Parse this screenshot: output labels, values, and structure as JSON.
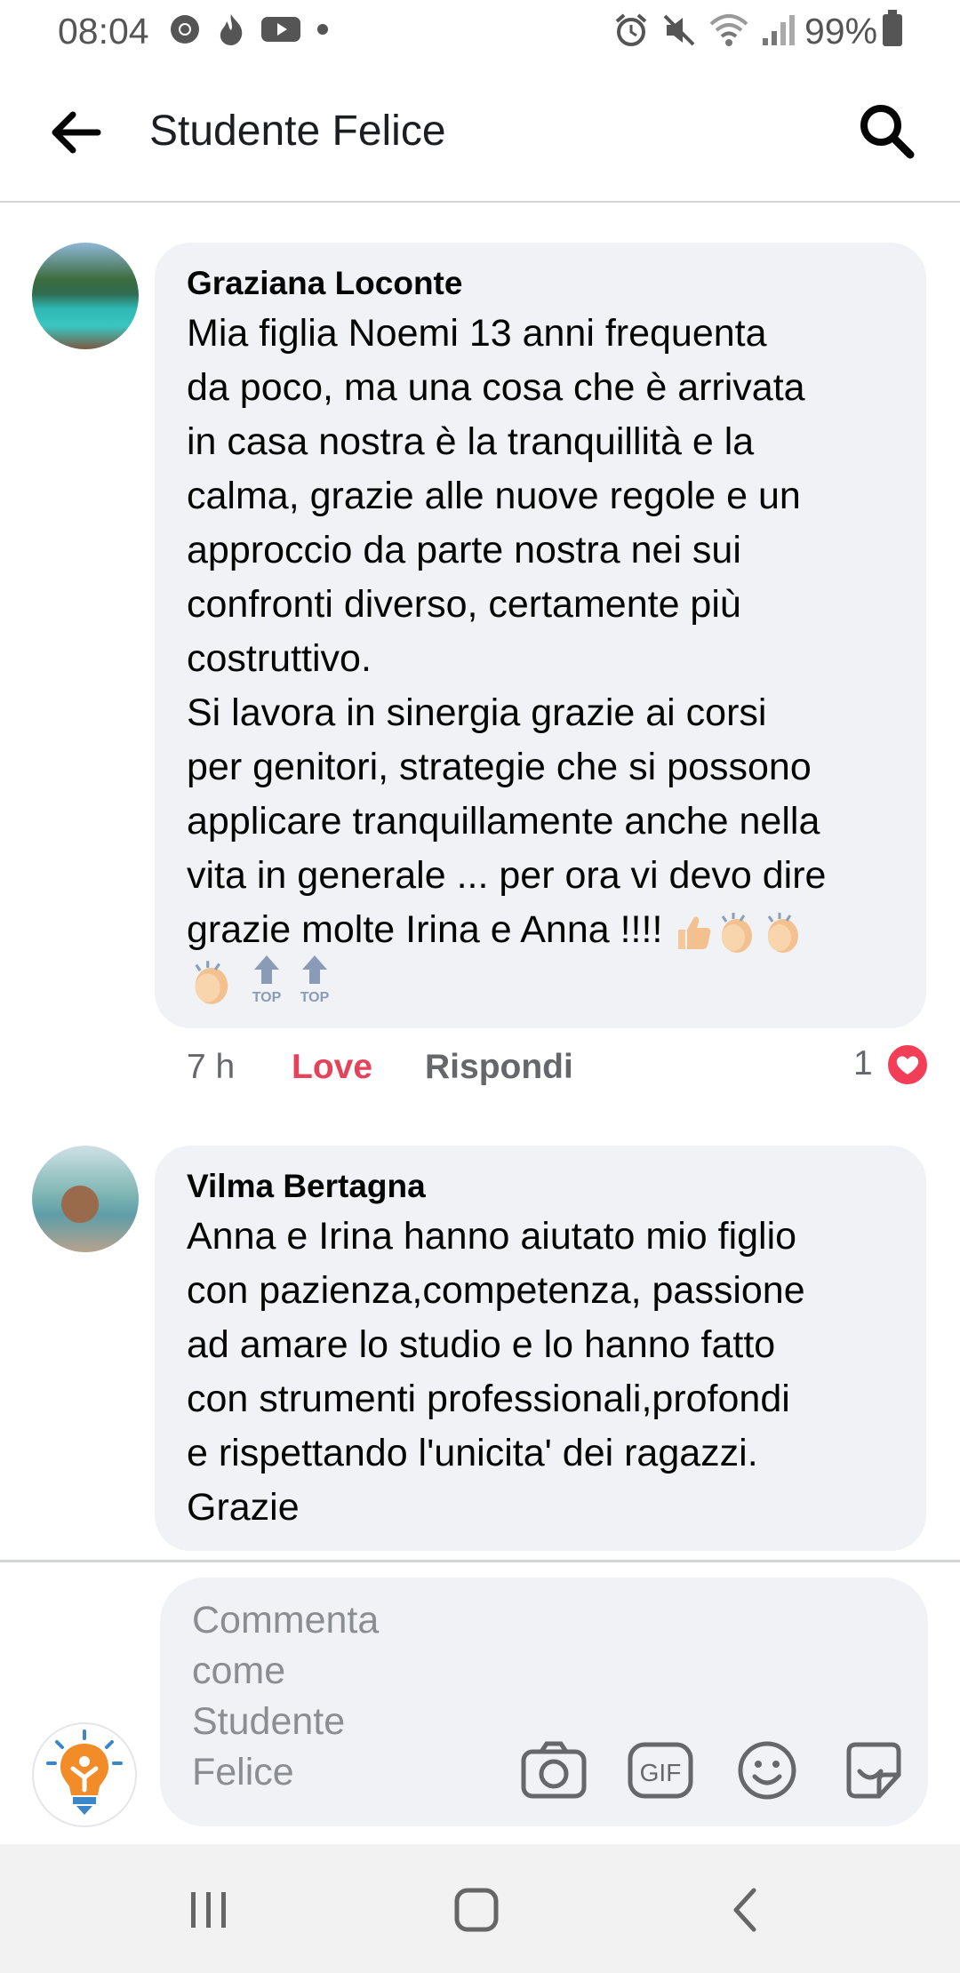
{
  "status_bar": {
    "time": "08:04",
    "battery": "99%",
    "left_icons": [
      "chrome-icon",
      "fire-icon",
      "youtube-icon",
      "dot-icon"
    ],
    "right_icons": [
      "alarm-icon",
      "mute-icon",
      "wifi-icon",
      "signal-icon"
    ]
  },
  "header": {
    "title": "Studente Felice",
    "back_icon": "arrow-left-icon",
    "search_icon": "search-icon"
  },
  "comments": [
    {
      "author": "Graziana Loconte",
      "text": "Mia figlia Noemi 13 anni frequenta\nda poco, ma una cosa che è arrivata\nin casa nostra è la tranquillità e la\ncalma, grazie alle nuove regole e un\napproccio da parte nostra nei sui\nconfronti diverso, certamente più\ncostruttivo.\nSi lavora in sinergia grazie ai corsi\nper genitori, strategie che si possono\napplicare tranquillamente anche nella\nvita in generale ... per ora vi devo dire\ngrazie molte Irina e Anna !!!! ",
      "emojis": [
        "thumbs-up",
        "clapping-hands",
        "clapping-hands",
        "clapping-hands",
        "top-arrow",
        "top-arrow"
      ],
      "top_badge": "TOP",
      "time": "7 h",
      "love_label": "Love",
      "reply_label": "Rispondi",
      "reaction_count": "1"
    },
    {
      "author": "Vilma Bertagna",
      "text": "Anna e Irina hanno aiutato mio figlio\ncon pazienza,competenza, passione\nad amare lo studio e lo hanno fatto\ncon strumenti professionali,profondi\ne rispettando l'unicita' dei ragazzi.\nGrazie"
    }
  ],
  "composer": {
    "placeholder": "Commenta\ncome\nStudente\nFelice",
    "icons": [
      "camera-icon",
      "gif-icon",
      "emoji-icon",
      "sticker-icon"
    ],
    "gif_label": "GIF"
  },
  "colors": {
    "love": "#e4435c",
    "bubble_bg": "#f0f2f5",
    "heart": "#f33e58",
    "brand_orange": "#f28c28"
  }
}
